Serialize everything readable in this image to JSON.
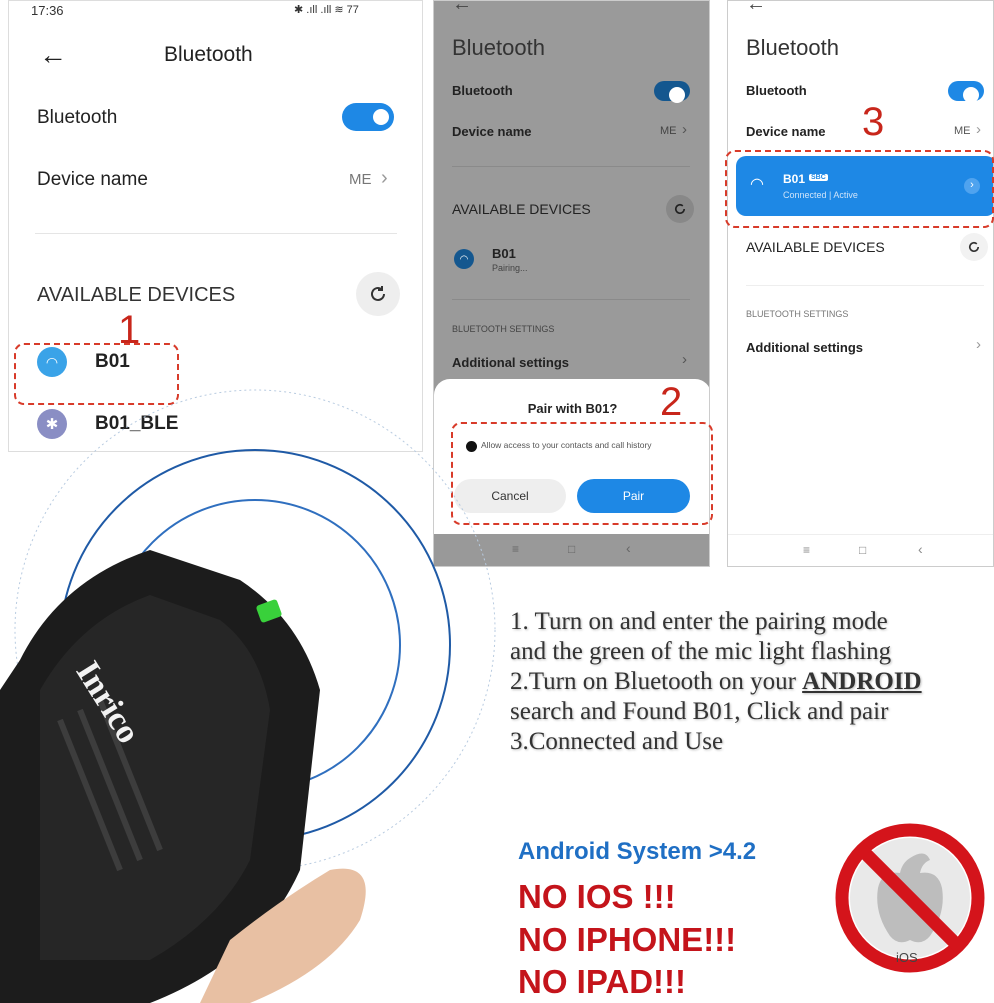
{
  "panel1": {
    "status_time": "17:36",
    "status_right": "✱ .ıll .ıll ≋ 77",
    "title": "Bluetooth",
    "bt_label": "Bluetooth",
    "device_name_label": "Device name",
    "device_name_value": "ME",
    "available_header": "AVAILABLE DEVICES",
    "devices": [
      "B01",
      "B01_BLE"
    ],
    "step": "1"
  },
  "panel2": {
    "title": "Bluetooth",
    "bt_label": "Bluetooth",
    "device_name_label": "Device name",
    "device_name_value": "ME",
    "available_header": "AVAILABLE DEVICES",
    "device_name": "B01",
    "device_status": "Pairing...",
    "settings_header": "BLUETOOTH SETTINGS",
    "additional": "Additional settings",
    "dialog_title": "Pair with B01?",
    "dialog_check": "Allow access to your contacts and call history",
    "cancel": "Cancel",
    "pair": "Pair",
    "step": "2"
  },
  "panel3": {
    "title": "Bluetooth",
    "bt_label": "Bluetooth",
    "device_name_label": "Device name",
    "device_name_value": "ME",
    "connected_device": "B01",
    "codec_badge": "SBC",
    "connected_status": "Connected | Active",
    "available_header": "AVAILABLE DEVICES",
    "settings_header": "BLUETOOTH SETTINGS",
    "additional": "Additional settings",
    "step": "3"
  },
  "product": {
    "brand": "Inrico"
  },
  "instructions": {
    "line1": "1. Turn on and enter the pairing mode",
    "line2": "and the green of the mic light flashing",
    "line3_prefix": "2.Turn on Bluetooth on your ",
    "line3_emph": "ANDROID",
    "line4": "search and Found B01, Click and pair",
    "line5": "3.Connected and Use"
  },
  "warnings": {
    "android": "Android System >4.2",
    "no_ios": "NO IOS !!!",
    "no_iphone": "NO IPHONE!!!",
    "no_ipad": "NO IPAD!!!",
    "ios_label": "iOS"
  },
  "colors": {
    "accent": "#1e88e5",
    "warning_red": "#c4141b",
    "android_blue": "#1f6fc4"
  }
}
